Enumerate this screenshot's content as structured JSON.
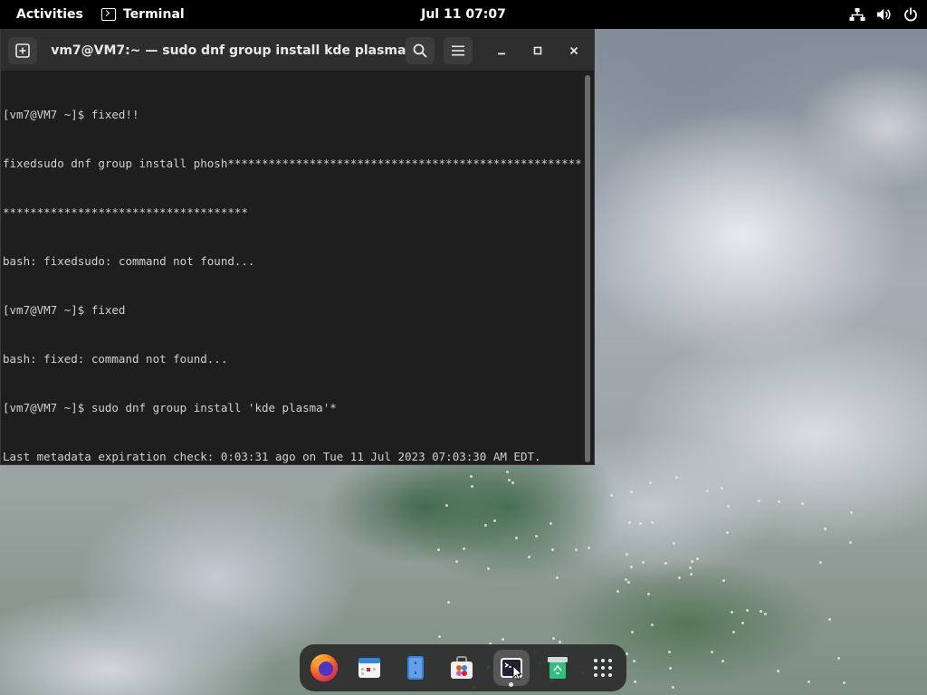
{
  "topbar": {
    "activities": "Activities",
    "app_name": "Terminal",
    "clock": "Jul 11  07:07",
    "status_icons": [
      "network-icon",
      "volume-icon",
      "power-icon"
    ]
  },
  "window": {
    "title": "vm7@VM7:~ — sudo dnf group install kde plasma*",
    "buttons": [
      "new-tab-icon",
      "search-icon",
      "hamburger-menu-icon",
      "minimize-icon",
      "maximize-icon",
      "close-icon"
    ]
  },
  "terminal": {
    "lines": [
      "[vm7@VM7 ~]$ fixed!!",
      "fixedsudo dnf group install phosh*****************************************************",
      "************************************",
      "bash: fixedsudo: command not found...",
      "[vm7@VM7 ~]$ fixed",
      "bash: fixed: command not found...",
      "[vm7@VM7 ~]$ sudo dnf group install 'kde plasma'*",
      "Last metadata expiration check: 0:03:31 ago on Tue 11 Jul 2023 07:03:30 AM EDT."
    ]
  },
  "dock": {
    "items": [
      {
        "name": "firefox-icon"
      },
      {
        "name": "calendar-icon"
      },
      {
        "name": "files-icon"
      },
      {
        "name": "software-icon"
      },
      {
        "name": "terminal-icon",
        "active": true
      },
      {
        "name": "trash-icon"
      },
      {
        "name": "app-grid-icon"
      }
    ]
  },
  "colors": {
    "topbar_bg": "#000000",
    "headerbar_bg": "#2e2e2e",
    "terminal_bg": "#1e1e1e",
    "terminal_fg": "#d0d0d0",
    "dock_bg": "#282828"
  }
}
